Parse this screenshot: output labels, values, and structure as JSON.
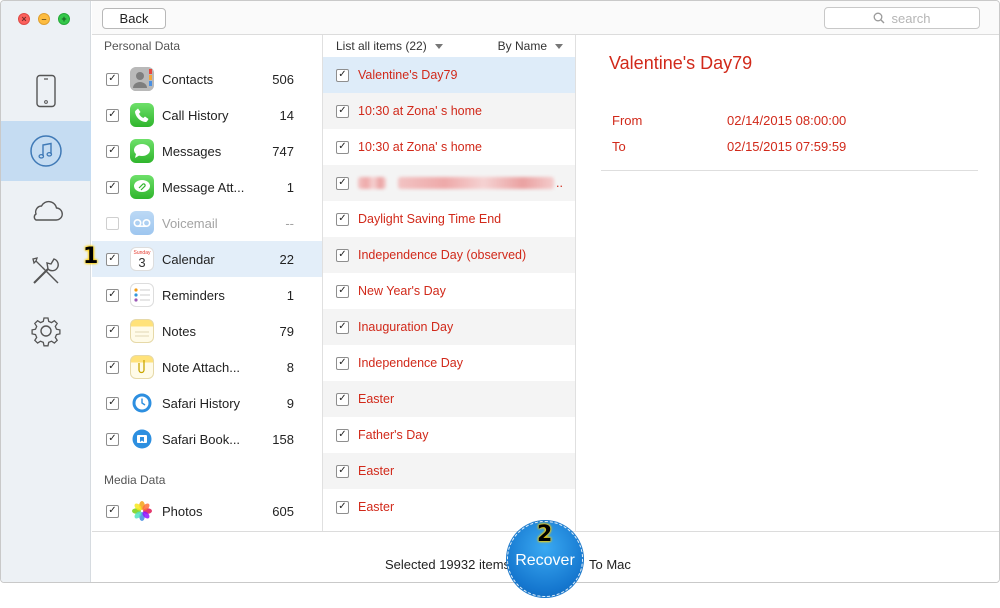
{
  "toolbar": {
    "back_label": "Back",
    "search_placeholder": "search"
  },
  "nav": {
    "items": [
      {
        "icon": "phone-icon",
        "active": false
      },
      {
        "icon": "music-icon",
        "active": true
      },
      {
        "icon": "cloud-icon",
        "active": false
      },
      {
        "icon": "tools-icon",
        "active": false
      },
      {
        "icon": "gear-icon",
        "active": false
      }
    ]
  },
  "categories": {
    "personal_title": "Personal Data",
    "media_title": "Media Data",
    "items": [
      {
        "name": "Contacts",
        "count": "506",
        "checked": true,
        "icon": "contacts-icon"
      },
      {
        "name": "Call History",
        "count": "14",
        "checked": true,
        "icon": "phone-call-icon"
      },
      {
        "name": "Messages",
        "count": "747",
        "checked": true,
        "icon": "messages-icon"
      },
      {
        "name": "Message Att...",
        "count": "1",
        "checked": true,
        "icon": "message-attachment-icon"
      },
      {
        "name": "Voicemail",
        "count": "--",
        "checked": false,
        "icon": "voicemail-icon"
      },
      {
        "name": "Calendar",
        "count": "22",
        "checked": true,
        "icon": "calendar-icon"
      },
      {
        "name": "Reminders",
        "count": "1",
        "checked": true,
        "icon": "reminders-icon"
      },
      {
        "name": "Notes",
        "count": "79",
        "checked": true,
        "icon": "notes-icon"
      },
      {
        "name": "Note Attach...",
        "count": "8",
        "checked": true,
        "icon": "note-attachment-icon"
      },
      {
        "name": "Safari History",
        "count": "9",
        "checked": true,
        "icon": "safari-history-icon"
      },
      {
        "name": "Safari Book...",
        "count": "158",
        "checked": true,
        "icon": "safari-bookmark-icon"
      }
    ],
    "media_items": [
      {
        "name": "Photos",
        "count": "605",
        "checked": true,
        "icon": "photos-icon"
      }
    ],
    "calendar_icon_day": "Sunday",
    "calendar_icon_date": "3"
  },
  "list": {
    "header_label": "List all items (22)",
    "sort_label": "By Name",
    "items": [
      "Valentine's Day79",
      "10:30 at Zona' s home",
      "10:30 at Zona' s home",
      "",
      "Daylight Saving Time End",
      "Independence Day (observed)",
      "New Year's Day",
      "Inauguration Day",
      "Independence Day",
      "Easter",
      "Father's Day",
      "Easter",
      "Easter"
    ],
    "blurred_suffix": ".."
  },
  "detail": {
    "title": "Valentine's Day79",
    "from_label": "From",
    "from_value": "02/14/2015 08:00:00",
    "to_label": "To",
    "to_value": "02/15/2015 07:59:59"
  },
  "footer": {
    "selected_text": "Selected 19932 items",
    "recover_label": "Recover",
    "to_mac_text": "To Mac"
  },
  "annotations": {
    "step1": "1",
    "step2": "2"
  },
  "colors": {
    "accent_red": "#d1291a",
    "selection_blue": "#c5dcf2",
    "recover_blue": "#1577cf"
  }
}
